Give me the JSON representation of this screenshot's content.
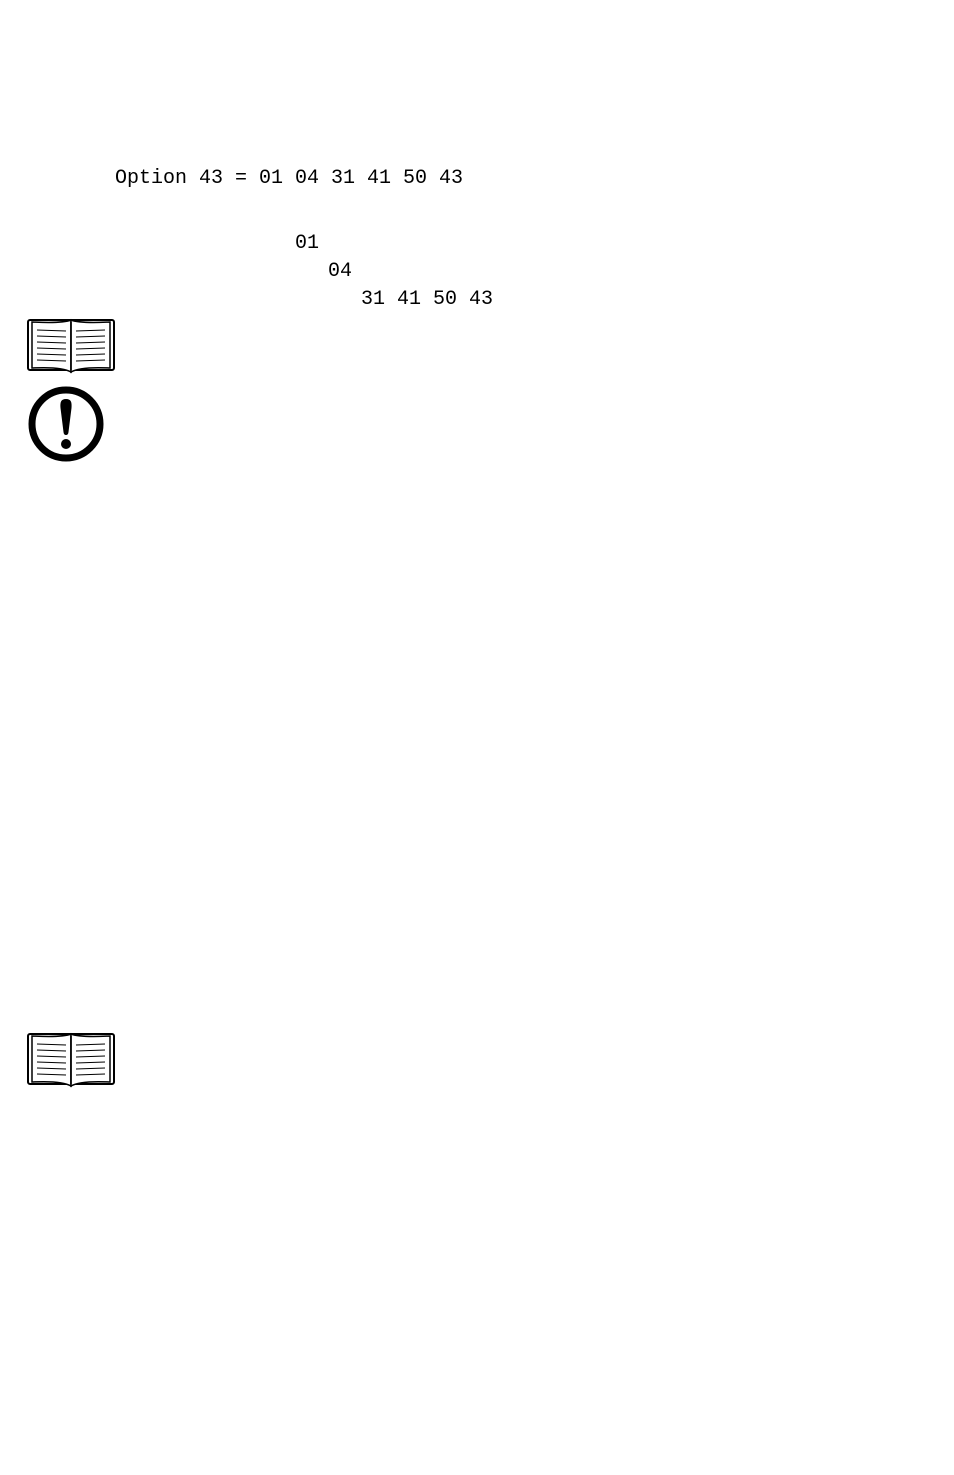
{
  "line_option": "Option 43 = 01 04 31 41 50 43",
  "line_01": "01",
  "line_04": "04",
  "line_hex": "31 41 50 43"
}
